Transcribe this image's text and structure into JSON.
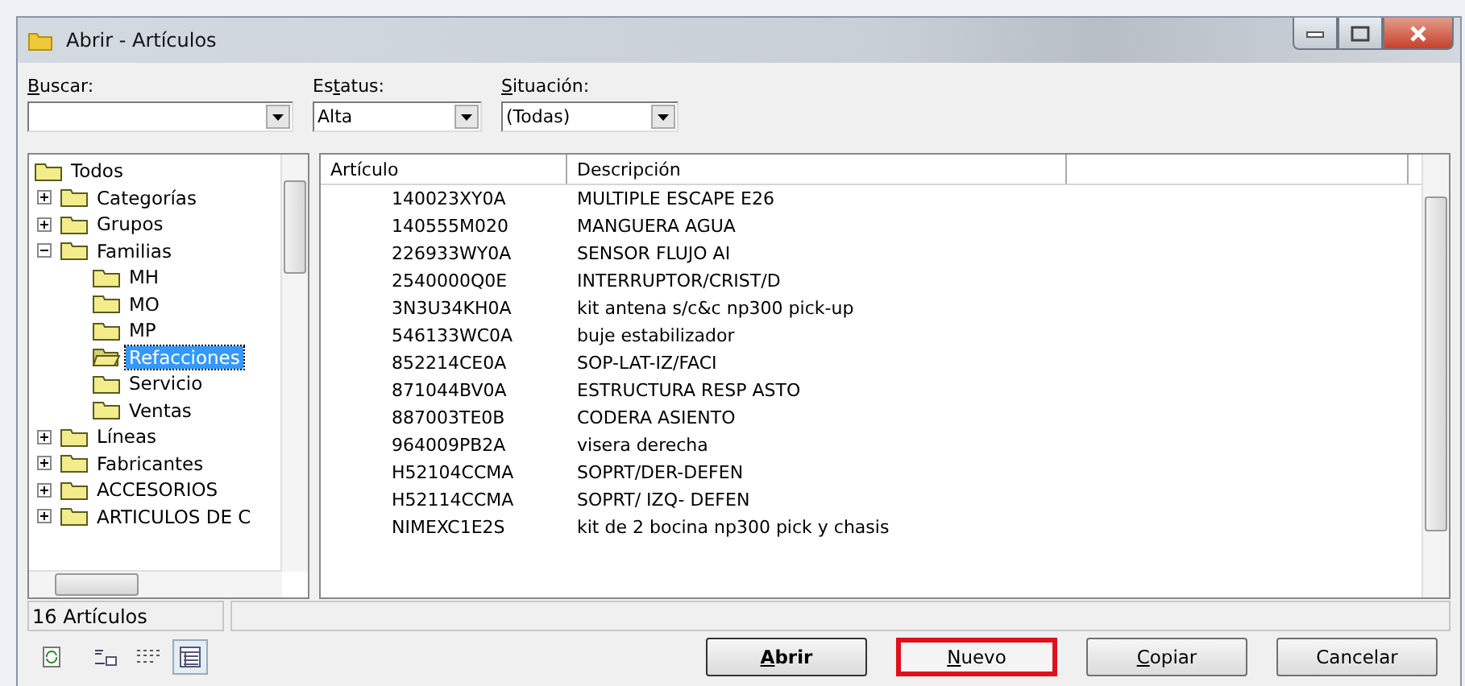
{
  "window": {
    "title": "Abrir - Artículos"
  },
  "filters": [
    {
      "label": {
        "key": "B",
        "after": "uscar:"
      }
    },
    {
      "label": {
        "before": "Es",
        "key": "t",
        "after": "atus:"
      },
      "value": "Alta"
    },
    {
      "label": {
        "key": "S",
        "after": "ituación:"
      },
      "value": "(Todas)"
    }
  ],
  "tree": [
    {
      "label": "Todos",
      "selected": false,
      "children": [
        {
          "label": "Categorías",
          "expanded": false,
          "selected": false
        },
        {
          "label": "Grupos",
          "expanded": false,
          "selected": false
        },
        {
          "label": "Familias",
          "expanded": true,
          "selected": false,
          "children": [
            {
              "label": "MH",
              "selected": false
            },
            {
              "label": "MO",
              "selected": false
            },
            {
              "label": "MP",
              "selected": false
            },
            {
              "label": "Refacciones",
              "selected": true
            },
            {
              "label": "Servicio",
              "selected": false
            },
            {
              "label": "Ventas",
              "selected": false
            }
          ]
        },
        {
          "label": "Líneas",
          "expanded": false,
          "selected": false
        },
        {
          "label": "Fabricantes",
          "expanded": false,
          "selected": false
        },
        {
          "label": "ACCESORIOS",
          "expanded": false,
          "selected": false
        },
        {
          "label": "ARTICULOS DE C",
          "expanded": false,
          "selected": false
        }
      ]
    }
  ],
  "table": {
    "columns": [
      "Artículo",
      "Descripción"
    ],
    "rows": [
      [
        "140023XY0A",
        "MULTIPLE ESCAPE E26"
      ],
      [
        "140555M020",
        "MANGUERA AGUA"
      ],
      [
        "226933WY0A",
        "SENSOR FLUJO AI"
      ],
      [
        "2540000Q0E",
        "INTERRUPTOR/CRIST/D"
      ],
      [
        "3N3U34KH0A",
        "kit antena s/c&c np300 pick-up"
      ],
      [
        "546133WC0A",
        "buje estabilizador"
      ],
      [
        "852214CE0A",
        "SOP-LAT-IZ/FACI"
      ],
      [
        "871044BV0A",
        "ESTRUCTURA RESP ASTO"
      ],
      [
        "887003TE0B",
        "CODERA ASIENTO"
      ],
      [
        "964009PB2A",
        "visera derecha"
      ],
      [
        "H52104CCMA",
        "SOPRT/DER-DEFEN"
      ],
      [
        "H52114CCMA",
        "SOPRT/ IZQ- DEFEN"
      ],
      [
        "NIMEXC1E2S",
        "kit de 2 bocina np300 pick y chasis"
      ]
    ]
  },
  "status_bar": {
    "count": "16 Artículos"
  },
  "view_buttons": [
    {
      "kind": "refresh",
      "selected": false
    },
    {
      "kind": "small-icons",
      "selected": false
    },
    {
      "kind": "list",
      "selected": false
    },
    {
      "kind": "details",
      "selected": true
    }
  ],
  "buttons": [
    {
      "label": {
        "key": "A",
        "after": "brir"
      },
      "default": true,
      "highlighted": false
    },
    {
      "label": {
        "key": "N",
        "after": "uevo"
      },
      "default": false,
      "highlighted": true
    },
    {
      "label": {
        "key": "C",
        "after": "opiar"
      },
      "default": false,
      "highlighted": false
    },
    {
      "label": {
        "before": "Cancelar"
      },
      "default": false,
      "highlighted": false
    }
  ]
}
